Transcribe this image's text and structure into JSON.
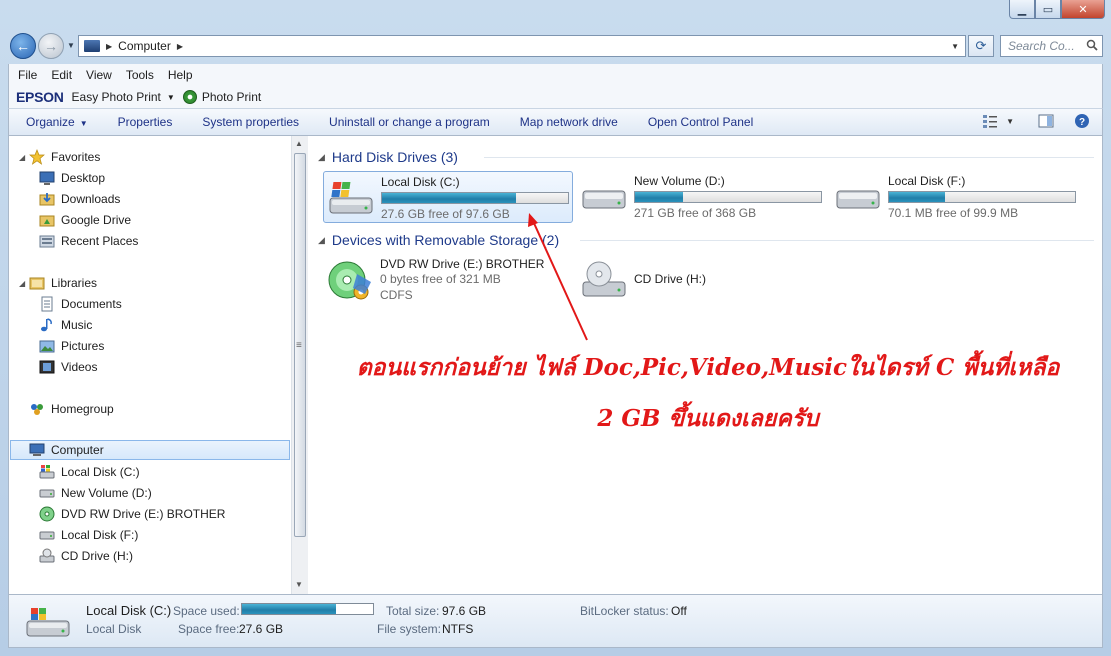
{
  "address": {
    "crumb": "Computer",
    "search_placeholder": "Search Co..."
  },
  "menu": [
    "File",
    "Edit",
    "View",
    "Tools",
    "Help"
  ],
  "epson": {
    "logo": "EPSON",
    "easy_photo_print": "Easy Photo Print",
    "photo_print": "Photo Print"
  },
  "commands": {
    "organize": "Organize",
    "properties": "Properties",
    "system_properties": "System properties",
    "uninstall": "Uninstall or change a program",
    "map_drive": "Map network drive",
    "control_panel": "Open Control Panel"
  },
  "nav": {
    "favorites": "Favorites",
    "desktop": "Desktop",
    "downloads": "Downloads",
    "google_drive": "Google Drive",
    "recent_places": "Recent Places",
    "libraries": "Libraries",
    "documents": "Documents",
    "music": "Music",
    "pictures": "Pictures",
    "videos": "Videos",
    "homegroup": "Homegroup",
    "computer": "Computer",
    "local_c": "Local Disk (C:)",
    "new_volume_d": "New Volume (D:)",
    "dvd_e": "DVD RW Drive (E:) BROTHER",
    "local_f": "Local Disk (F:)",
    "cd_h": "CD Drive (H:)"
  },
  "groups": {
    "hard_disk": "Hard Disk Drives (3)",
    "removable": "Devices with Removable Storage (2)"
  },
  "drives": {
    "c": {
      "name": "Local Disk (C:)",
      "free": "27.6 GB free of 97.6 GB",
      "used_fraction": 0.72
    },
    "d": {
      "name": "New Volume (D:)",
      "free": "271 GB free of 368 GB",
      "used_fraction": 0.26
    },
    "f": {
      "name": "Local Disk (F:)",
      "free": "70.1 MB free of 99.9 MB",
      "used_fraction": 0.3
    },
    "e": {
      "name": "DVD RW Drive (E:) BROTHER",
      "free": "0 bytes free of 321 MB",
      "fs": "CDFS"
    },
    "h": {
      "name": "CD Drive (H:)"
    }
  },
  "annotation": {
    "line1": "ตอนแรกก่อนย้าย ไฟล์ Doc,Pic,Video,Musicในไดรท์ C พื้นที่เหลือ",
    "line2": "2 GB ขึ้นแดงเลยครับ",
    "color": "#e21818"
  },
  "details": {
    "title": "Local Disk (C:)",
    "subtitle": "Local Disk",
    "space_used_label": "Space used:",
    "space_free_label": "Space free:",
    "space_free": "27.6 GB",
    "total_size_label": "Total size:",
    "total_size": "97.6 GB",
    "file_system_label": "File system:",
    "file_system": "NTFS",
    "bitlocker_label": "BitLocker status:",
    "bitlocker": "Off",
    "used_fraction": 0.72
  },
  "colors": {
    "accent": "#1e3a8a",
    "progress": "#217ea8"
  }
}
